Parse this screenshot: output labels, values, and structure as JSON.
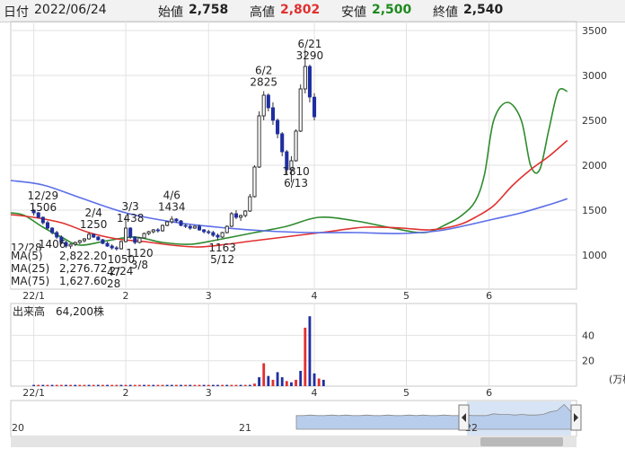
{
  "header": {
    "date_label": "日付",
    "date": "2022/06/24",
    "open_label": "始値",
    "open": "2,758",
    "high_label": "高値",
    "high": "2,802",
    "low_label": "安値",
    "low": "2,500",
    "close_label": "終値",
    "close": "2,540"
  },
  "colors": {
    "up": "#e03030",
    "down": "#1f2fa0",
    "ma5": "#2e8b2e",
    "ma25": "#e03030",
    "ma75": "#5b6ee8",
    "high_value": "#e03030",
    "low_value": "#1e8a1e"
  },
  "legend": [
    {
      "label": "MA(5)",
      "value": "2,822.20"
    },
    {
      "label": "MA(25)",
      "value": "2,276.72"
    },
    {
      "label": "MA(75)",
      "value": "1,627.60"
    }
  ],
  "volume_label": "出来高",
  "volume_value": "64,200株",
  "volume_unit": "(万株",
  "chart_data": [
    {
      "type": "candlestick",
      "title": "",
      "ylim": [
        620,
        3600
      ],
      "yticks": [
        1000,
        1500,
        2000,
        2500,
        3000,
        3500
      ],
      "xticks": [
        {
          "label": "22/1",
          "index": 0
        },
        {
          "label": "2",
          "index": 20
        },
        {
          "label": "3",
          "index": 38
        },
        {
          "label": "4",
          "index": 61
        },
        {
          "label": "5",
          "index": 81
        },
        {
          "label": "6",
          "index": 99
        }
      ],
      "first_index": -5,
      "last_index": 118,
      "series": [
        {
          "name": "MA(5)",
          "x": [
            -5,
            -2,
            2,
            6,
            10,
            16,
            22,
            28,
            34,
            40,
            48,
            55,
            62,
            70,
            78,
            85,
            90,
            93,
            96,
            98,
            100,
            103,
            106,
            108,
            110,
            112,
            114,
            116
          ],
          "values": [
            1470,
            1440,
            1310,
            1200,
            1110,
            1160,
            1200,
            1140,
            1120,
            1170,
            1250,
            1320,
            1420,
            1380,
            1300,
            1250,
            1350,
            1440,
            1600,
            1900,
            2500,
            2700,
            2500,
            2000,
            1950,
            2400,
            2820,
            2822
          ]
        },
        {
          "name": "MA(25)",
          "x": [
            -5,
            0,
            6,
            12,
            18,
            24,
            30,
            36,
            42,
            48,
            56,
            64,
            72,
            80,
            86,
            92,
            96,
            100,
            104,
            108,
            112,
            116
          ],
          "values": [
            1450,
            1420,
            1360,
            1250,
            1180,
            1150,
            1110,
            1090,
            1120,
            1160,
            1210,
            1260,
            1310,
            1300,
            1280,
            1330,
            1420,
            1550,
            1770,
            1950,
            2100,
            2276
          ]
        },
        {
          "name": "MA(75)",
          "x": [
            -5,
            2,
            10,
            20,
            30,
            40,
            50,
            60,
            70,
            80,
            88,
            94,
            100,
            106,
            112,
            116
          ],
          "values": [
            1830,
            1780,
            1640,
            1470,
            1370,
            1310,
            1270,
            1250,
            1250,
            1240,
            1270,
            1330,
            1400,
            1470,
            1560,
            1627
          ]
        }
      ],
      "candles": [
        [
          1500,
          1510,
          1440,
          1470
        ],
        [
          1470,
          1480,
          1410,
          1420
        ],
        [
          1420,
          1430,
          1340,
          1360
        ],
        [
          1360,
          1380,
          1280,
          1300
        ],
        [
          1300,
          1310,
          1230,
          1250
        ],
        [
          1250,
          1270,
          1180,
          1200
        ],
        [
          1200,
          1220,
          1120,
          1140
        ],
        [
          1140,
          1160,
          1080,
          1100
        ],
        [
          1100,
          1130,
          1070,
          1120
        ],
        [
          1120,
          1150,
          1100,
          1140
        ],
        [
          1140,
          1170,
          1120,
          1160
        ],
        [
          1160,
          1190,
          1140,
          1180
        ],
        [
          1180,
          1250,
          1170,
          1230
        ],
        [
          1230,
          1240,
          1190,
          1200
        ],
        [
          1200,
          1210,
          1160,
          1170
        ],
        [
          1170,
          1180,
          1120,
          1130
        ],
        [
          1130,
          1150,
          1090,
          1100
        ],
        [
          1100,
          1120,
          1060,
          1080
        ],
        [
          1080,
          1100,
          1050,
          1070
        ],
        [
          1070,
          1160,
          1060,
          1150
        ],
        [
          1150,
          1438,
          1140,
          1300
        ],
        [
          1300,
          1310,
          1180,
          1200
        ],
        [
          1200,
          1210,
          1120,
          1140
        ],
        [
          1140,
          1200,
          1130,
          1190
        ],
        [
          1190,
          1250,
          1180,
          1240
        ],
        [
          1240,
          1270,
          1220,
          1260
        ],
        [
          1260,
          1290,
          1240,
          1280
        ],
        [
          1280,
          1300,
          1250,
          1270
        ],
        [
          1270,
          1340,
          1260,
          1330
        ],
        [
          1330,
          1380,
          1320,
          1370
        ],
        [
          1370,
          1434,
          1350,
          1400
        ],
        [
          1400,
          1410,
          1360,
          1380
        ],
        [
          1380,
          1390,
          1320,
          1330
        ],
        [
          1330,
          1350,
          1300,
          1320
        ],
        [
          1320,
          1340,
          1280,
          1300
        ],
        [
          1300,
          1330,
          1290,
          1320
        ],
        [
          1320,
          1340,
          1270,
          1280
        ],
        [
          1280,
          1290,
          1240,
          1260
        ],
        [
          1260,
          1280,
          1230,
          1250
        ],
        [
          1250,
          1270,
          1200,
          1220
        ],
        [
          1220,
          1240,
          1163,
          1200
        ],
        [
          1200,
          1260,
          1190,
          1250
        ],
        [
          1250,
          1330,
          1240,
          1320
        ],
        [
          1320,
          1480,
          1310,
          1460
        ],
        [
          1460,
          1500,
          1400,
          1420
        ],
        [
          1420,
          1450,
          1380,
          1440
        ],
        [
          1440,
          1500,
          1420,
          1490
        ],
        [
          1490,
          1680,
          1480,
          1650
        ],
        [
          1650,
          2000,
          1640,
          1980
        ],
        [
          1980,
          2600,
          1970,
          2550
        ],
        [
          2550,
          2825,
          2500,
          2780
        ],
        [
          2780,
          2800,
          2600,
          2640
        ],
        [
          2640,
          2700,
          2450,
          2500
        ],
        [
          2500,
          2520,
          2300,
          2350
        ],
        [
          2350,
          2370,
          2100,
          2150
        ],
        [
          2150,
          2170,
          1900,
          1950
        ],
        [
          1950,
          2100,
          1810,
          2050
        ],
        [
          2050,
          2400,
          2040,
          2380
        ],
        [
          2380,
          2900,
          2370,
          2850
        ],
        [
          2850,
          3290,
          2800,
          3100
        ],
        [
          3100,
          3120,
          2700,
          2760
        ],
        [
          2758,
          2802,
          2500,
          2540
        ]
      ],
      "annotations": [
        {
          "index": 2,
          "lines": [
            "12/29",
            "1506"
          ],
          "pos": "above"
        },
        {
          "index": 4,
          "lines": [
            "1406"
          ],
          "pos": "below"
        },
        {
          "index": 13,
          "lines": [
            "2/4",
            "1250"
          ],
          "pos": "above"
        },
        {
          "index": 19,
          "lines": [
            "1050",
            "2/24"
          ],
          "pos": "below"
        },
        {
          "index": 21,
          "lines": [
            "3/3",
            "1438"
          ],
          "pos": "above"
        },
        {
          "index": 23,
          "lines": [
            "1120",
            "3/8"
          ],
          "pos": "below"
        },
        {
          "index": 30,
          "lines": [
            "4/6",
            "1434"
          ],
          "pos": "above"
        },
        {
          "index": 41,
          "lines": [
            "1163",
            "5/12"
          ],
          "pos": "below"
        },
        {
          "index": 50,
          "lines": [
            "6/2",
            "2825"
          ],
          "pos": "above"
        },
        {
          "index": 57,
          "lines": [
            "1810",
            "6/13"
          ],
          "pos": "below"
        },
        {
          "index": 60,
          "lines": [
            "6/21",
            "3290"
          ],
          "pos": "above"
        }
      ],
      "partial_labels": [
        "12/28",
        "47",
        "28"
      ]
    },
    {
      "type": "bar",
      "title": "出来高",
      "ylim": [
        0,
        65
      ],
      "yticks": [
        20,
        40
      ],
      "values": [
        1,
        1,
        1,
        1,
        1,
        1,
        1,
        1,
        1,
        1,
        1,
        1,
        1,
        1,
        1,
        1,
        1,
        1,
        1,
        1,
        1,
        1,
        1,
        1,
        1,
        1,
        1,
        1,
        1,
        1,
        1,
        1,
        1,
        1,
        1,
        1,
        1,
        1,
        1,
        1,
        1,
        1,
        1,
        1,
        1,
        1,
        1,
        1,
        2,
        7,
        18,
        8,
        5,
        11,
        7,
        4,
        3,
        5,
        12,
        46,
        55,
        10,
        6,
        5
      ],
      "up_flags": [
        0,
        1,
        0,
        1,
        0,
        1,
        1,
        0,
        1,
        0,
        1,
        1,
        0,
        1,
        0,
        1,
        0,
        1,
        1,
        0,
        1,
        0,
        1,
        1,
        0,
        1,
        0,
        1,
        1,
        0,
        0,
        1,
        0,
        1,
        0,
        1,
        1,
        0,
        1,
        0,
        0,
        1,
        0,
        1,
        1,
        0,
        1,
        0,
        1,
        0,
        1,
        0,
        1,
        0,
        0,
        1,
        0,
        1,
        0,
        1,
        0,
        0,
        1,
        0
      ]
    },
    {
      "type": "area",
      "title": "",
      "xticks": [
        "20",
        "21",
        "22"
      ],
      "values": [
        22,
        22,
        23,
        22,
        22,
        23,
        22,
        23,
        22,
        22,
        23,
        22,
        22,
        23,
        22,
        22,
        23,
        22,
        23,
        22,
        22,
        23,
        22,
        22,
        23,
        22,
        22,
        22,
        25,
        24,
        24,
        23,
        24,
        23,
        23,
        24,
        28,
        30,
        40,
        28
      ]
    }
  ]
}
